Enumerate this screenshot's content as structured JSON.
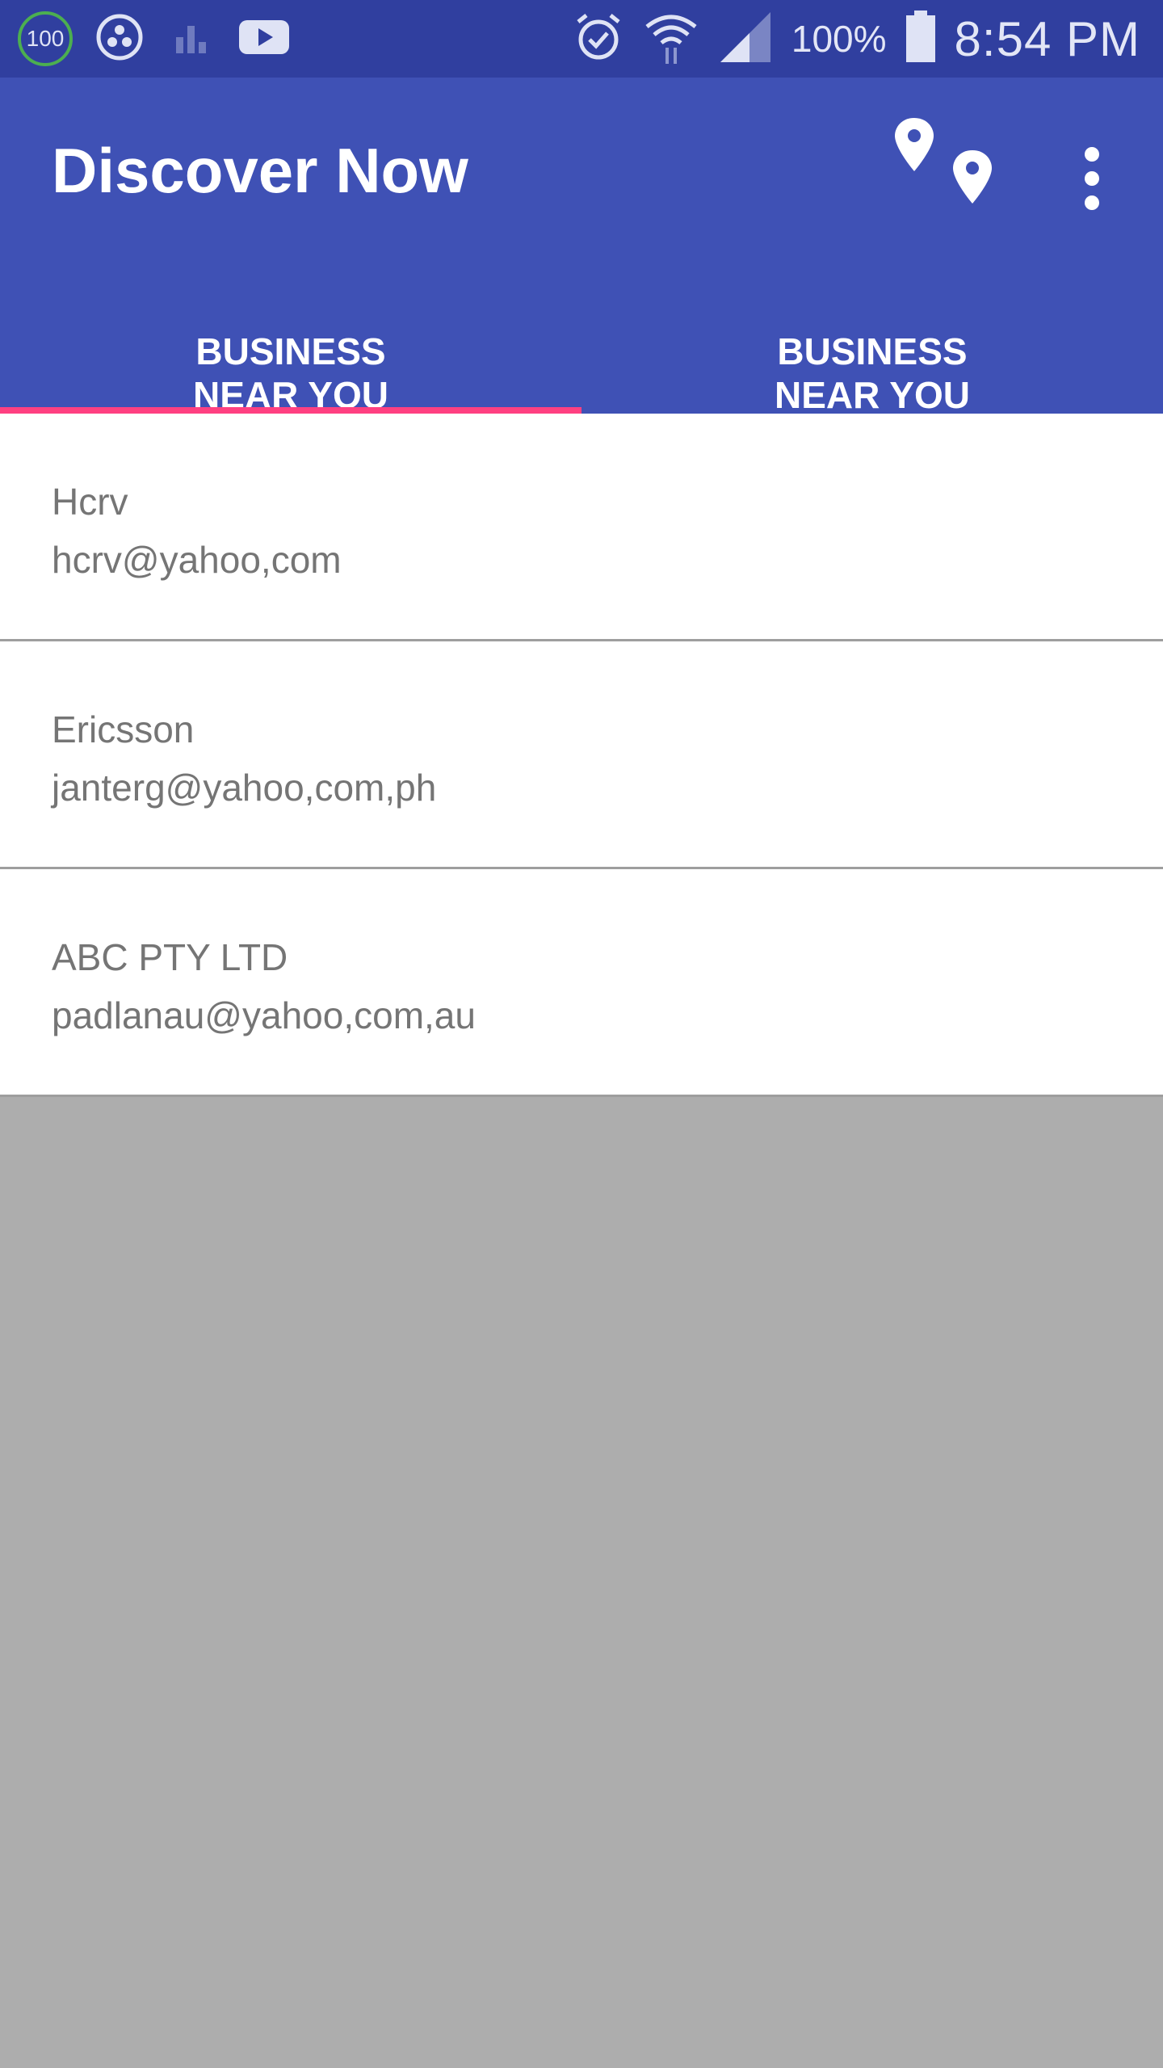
{
  "status_bar": {
    "notification_badge": "100",
    "battery_percent": "100%",
    "time": "8:54 PM",
    "icons": [
      "battery-saver-badge-icon",
      "hangouts-icon",
      "stats-icon",
      "youtube-icon",
      "alarm-icon",
      "wifi-icon",
      "signal-icon",
      "battery-icon"
    ]
  },
  "app_bar": {
    "title": "Discover Now",
    "color": "#3f51b5",
    "actions": [
      "map-markers-icon",
      "more-options-icon"
    ]
  },
  "tabs": [
    {
      "label": "BUSINESS\nNEAR YOU",
      "selected": true
    },
    {
      "label": "BUSINESS\nNEAR YOU",
      "selected": false
    }
  ],
  "accent_color": "#ff4081",
  "businesses": [
    {
      "name": "Hcrv",
      "email": "hcrv@yahoo,com"
    },
    {
      "name": "Ericsson",
      "email": "janterg@yahoo,com,ph"
    },
    {
      "name": "ABC PTY LTD",
      "email": "padlanau@yahoo,com,au"
    }
  ]
}
